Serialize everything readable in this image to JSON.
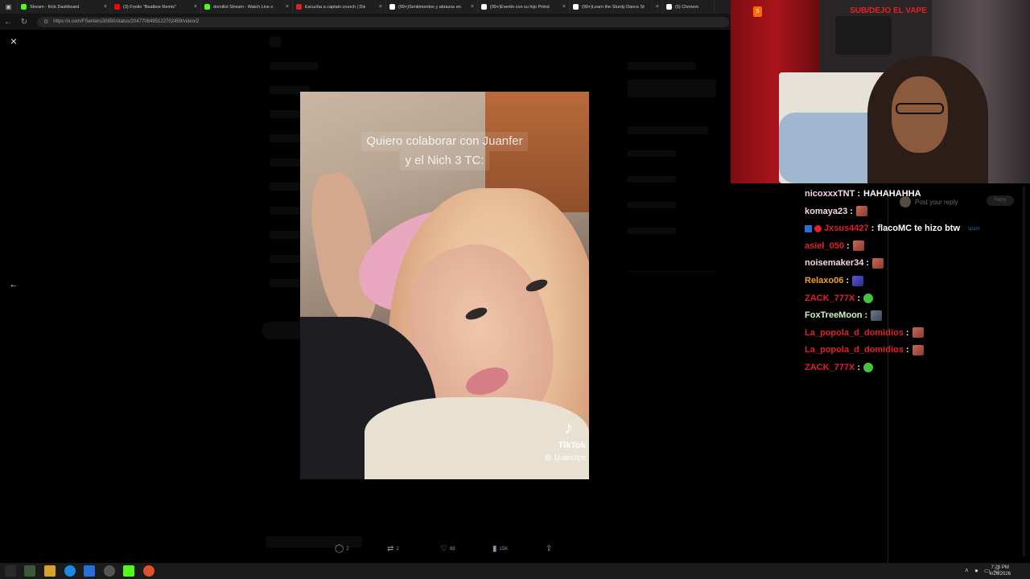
{
  "browser": {
    "tabs": [
      {
        "title": "Stream - Kick Dashboard",
        "color": "#53fc18"
      },
      {
        "title": "(3) Foolio \"Beatbox Remix\"",
        "color": "#ff0000"
      },
      {
        "title": "domiilol Stream - Watch Live o",
        "color": "#53fc18"
      },
      {
        "title": "Escucha a captain crunch | Dis",
        "color": "#e0202a"
      },
      {
        "title": "(99+)Sentimientos y abrazos en",
        "color": "#ffffff"
      },
      {
        "title": "(99+)Everito con su hijo Pnlnd",
        "color": "#ffffff"
      },
      {
        "title": "(99+)Learn the Sturdy Dance St",
        "color": "#ffffff"
      },
      {
        "title": "(5) Chonero",
        "color": "#ffffff"
      }
    ],
    "tab_close": "×",
    "url": "https://x.com/FSentero30850/status/2047708495122702459/video/2"
  },
  "viewer": {
    "close_icon": "×",
    "prev_icon": "←",
    "video_caption_line1": "Quiero colaborar con Juanfer",
    "video_caption_line2": "y el Nich 3 TC:",
    "tiktok_label": "TikTok",
    "tiktok_handle": "@ 1juanclips",
    "stats": {
      "replies": "2",
      "reposts": "2",
      "likes": "69",
      "views": "15K"
    }
  },
  "webcam": {
    "banner": "SUB/DEJO EL VAPE",
    "badge": "5"
  },
  "chat": {
    "messages": [
      {
        "user": "nicoxxxTNT",
        "color": "#f5d6e8",
        "text": "HAHAHAHHA",
        "emote": ""
      },
      {
        "user": "komaya23",
        "color": "#f5d6e8",
        "text": "",
        "emote": "red"
      },
      {
        "user": "Jxsus4427",
        "color": "#e0202a",
        "text": "flacoMC te hizo btw",
        "emote": "",
        "badges": true
      },
      {
        "user": "asiel_050",
        "color": "#e0202a",
        "text": "",
        "emote": "red"
      },
      {
        "user": "noisemaker34",
        "color": "#f5d6e8",
        "text": "",
        "emote": "red"
      },
      {
        "user": "Relaxo06",
        "color": "#f0a020",
        "text": "",
        "emote": "blue"
      },
      {
        "user": "ZACK_777X",
        "color": "#e0202a",
        "text": "",
        "emote": "green"
      },
      {
        "user": "FoxTreeMoon",
        "color": "#c8f5c0",
        "text": "",
        "emote": "gray"
      },
      {
        "user": "La_popola_d_domidios",
        "color": "#e0202a",
        "text": "",
        "emote": "red"
      },
      {
        "user": "La_popola_d_domidios",
        "color": "#e0202a",
        "text": "",
        "emote": "red"
      },
      {
        "user": "ZACK_777X",
        "color": "#e0202a",
        "text": "",
        "emote": "green"
      }
    ],
    "post_reply_placeholder": "Post your reply",
    "reply_button": "Reply",
    "spam_link": "spam"
  },
  "taskbar": {
    "time": "7:28 PM",
    "date": "4/26/2026"
  }
}
